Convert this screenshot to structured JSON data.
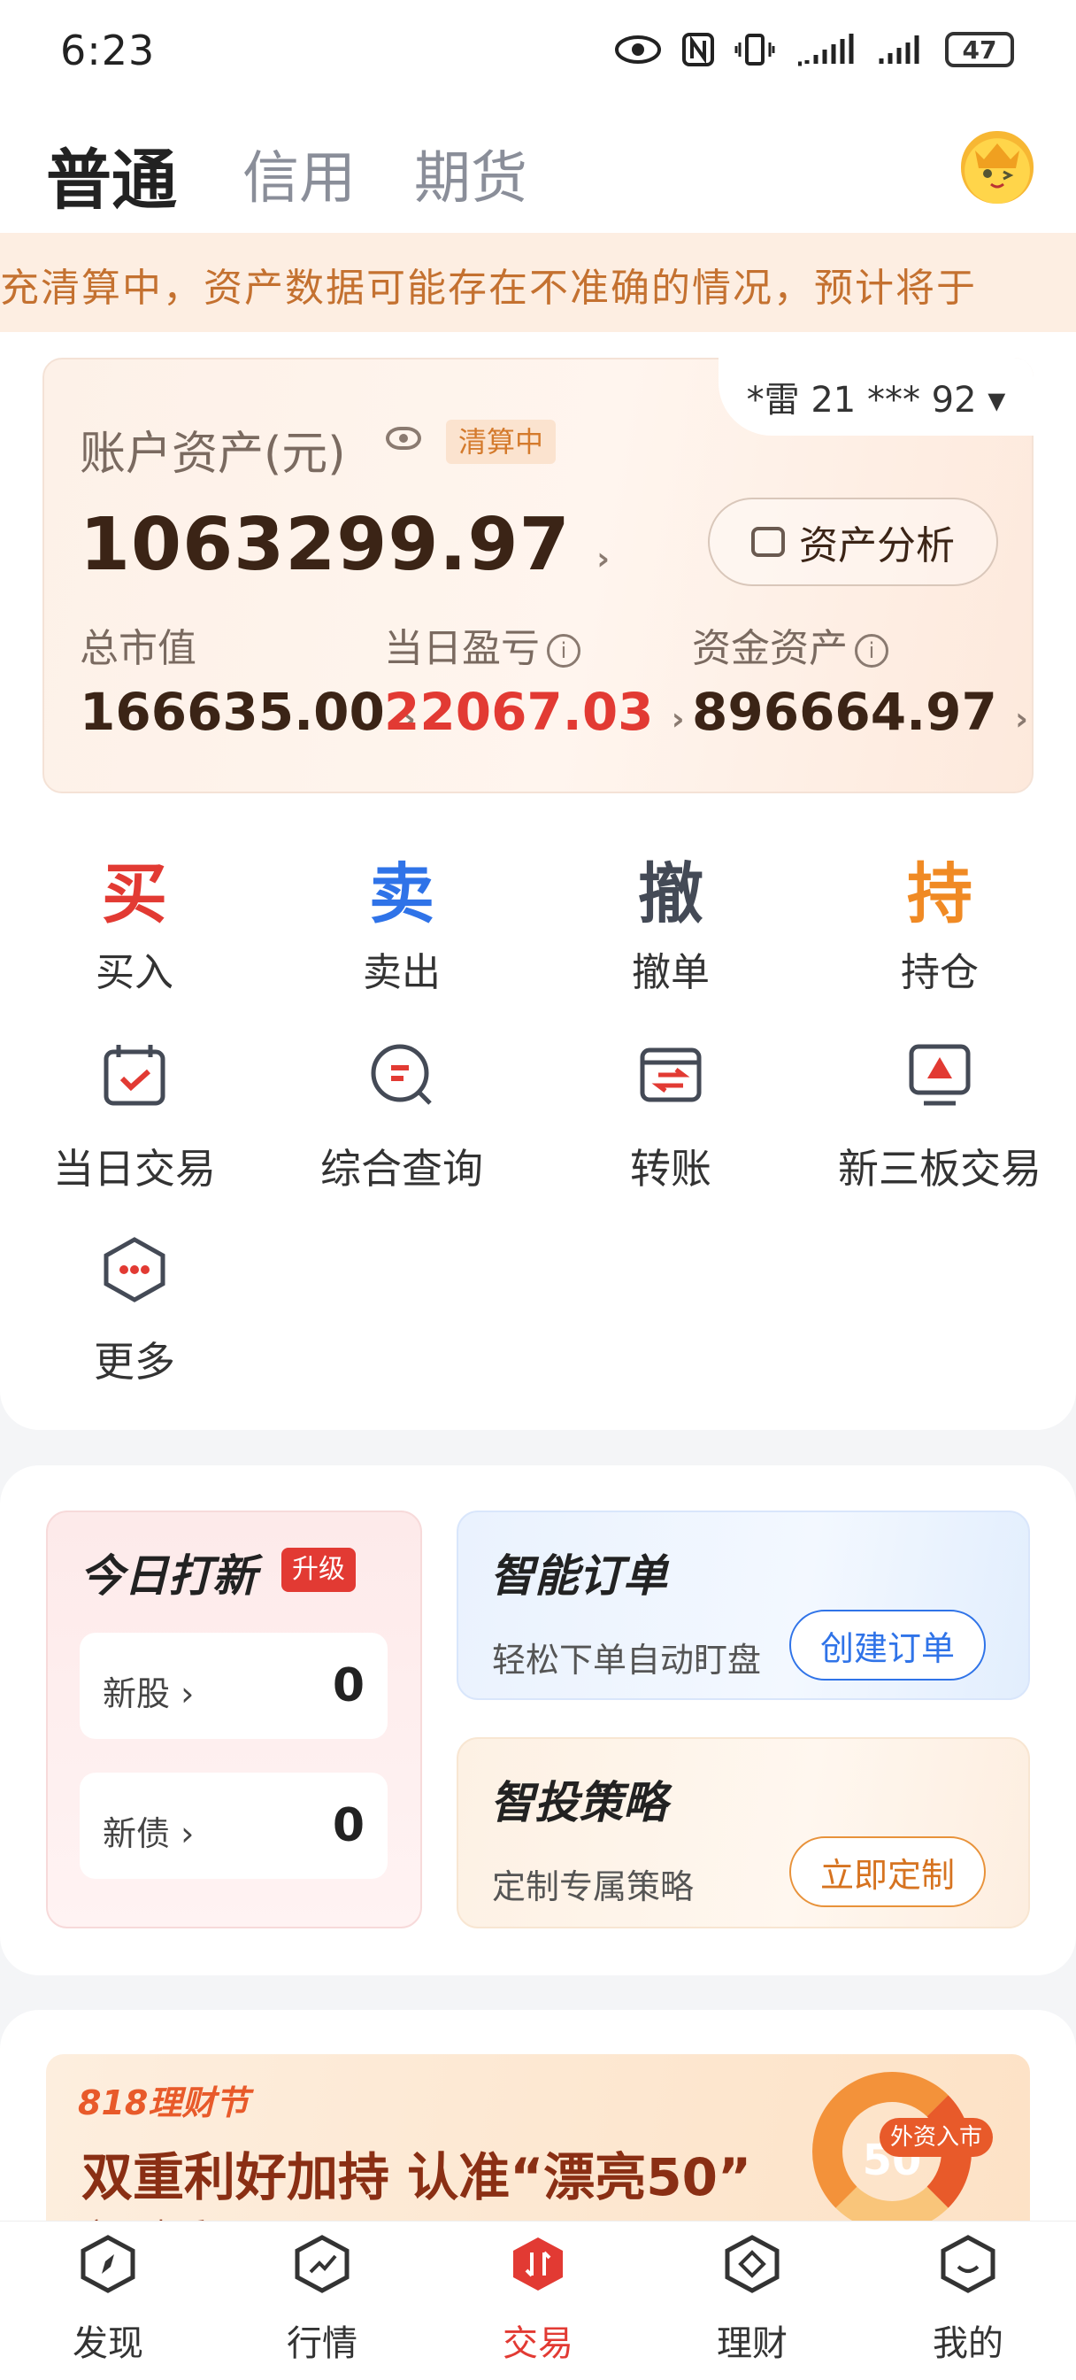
{
  "status_bar": {
    "time": "6:23",
    "battery": "47"
  },
  "header": {
    "tabs": [
      {
        "label": "普通"
      },
      {
        "label": "信用"
      },
      {
        "label": "期货"
      }
    ]
  },
  "notice": {
    "text": "充清算中，资产数据可能存在不准确的情况，预计将于"
  },
  "account": {
    "id": "*雷 21 *** 92 ▾",
    "total_label": "账户资产(元)",
    "status_badge": "清算中",
    "total_value": "1063299.97",
    "analysis_button": "资产分析",
    "metrics": [
      {
        "label": "总市值",
        "value": "166635.00"
      },
      {
        "label": "当日盈亏",
        "value": "22067.03"
      },
      {
        "label": "资金资产",
        "value": "896664.97"
      }
    ]
  },
  "actions": [
    {
      "char": "买",
      "label": "买入",
      "color": "#e23a33"
    },
    {
      "char": "卖",
      "label": "卖出",
      "color": "#2f73e8"
    },
    {
      "char": "撤",
      "label": "撤单",
      "color": "#444a56"
    },
    {
      "char": "持",
      "label": "持仓",
      "color": "#f08a24"
    }
  ],
  "functions": [
    {
      "label": "当日交易",
      "icon": "calendar-check-icon"
    },
    {
      "label": "综合查询",
      "icon": "search-doc-icon"
    },
    {
      "label": "转账",
      "icon": "transfer-icon"
    },
    {
      "label": "新三板交易",
      "icon": "monitor-icon"
    },
    {
      "label": "更多",
      "icon": "more-dots-icon"
    }
  ],
  "ipo": {
    "title": "今日打新",
    "badge": "升级",
    "rows": [
      {
        "label": "新股",
        "value": "0"
      },
      {
        "label": "新债",
        "value": "0"
      }
    ]
  },
  "smart_order": {
    "title": "智能订单",
    "subtitle": "轻松下单自动盯盘",
    "button": "创建订单"
  },
  "strategy": {
    "title": "智投策略",
    "subtitle": "定制专属策略",
    "button": "立即定制"
  },
  "banner": {
    "tag": "818理财节",
    "headline": "双重利好加持 认准“漂亮50”",
    "sub": "立即查看 >",
    "ring_number": "50",
    "ring_badge": "外资入市"
  },
  "bottom_nav": [
    {
      "label": "发现"
    },
    {
      "label": "行情"
    },
    {
      "label": "交易"
    },
    {
      "label": "理财"
    },
    {
      "label": "我的"
    }
  ]
}
